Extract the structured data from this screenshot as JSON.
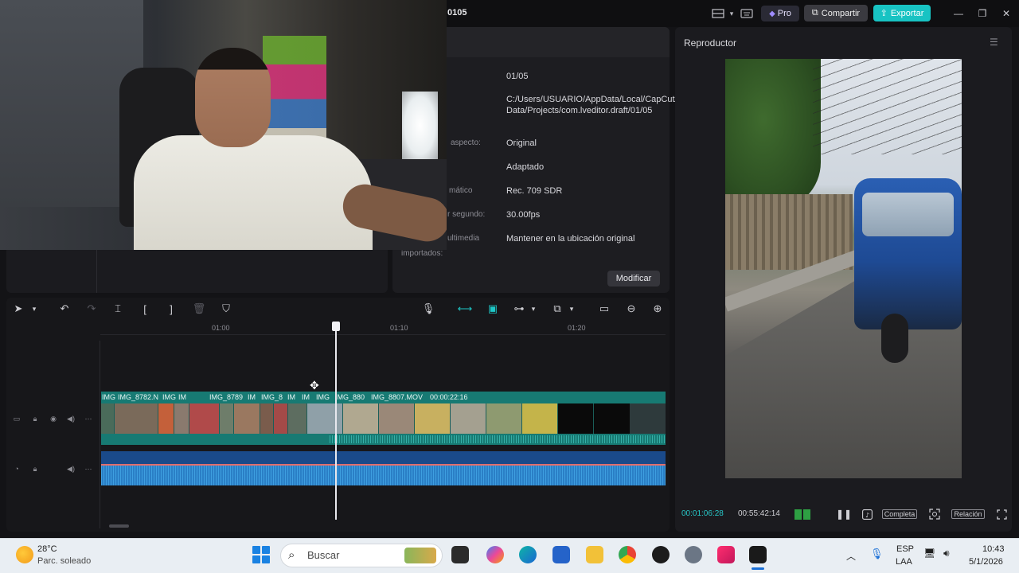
{
  "titlebar": {
    "project_name": "0105",
    "pro_label": "Pro",
    "share_label": "Compartir",
    "export_label": "Exportar",
    "icons": [
      "layout-icon",
      "chevron-down-icon",
      "keyboard-icon",
      "minimize-icon",
      "maximize-icon",
      "close-icon"
    ]
  },
  "info": {
    "rows": [
      {
        "label": "",
        "value": "01/05"
      },
      {
        "label": "",
        "value": "C:/Users/USUARIO/AppData/Local/CapCut/User Data/Projects/com.lveditor.draft/01/05"
      },
      {
        "label": "aspecto:",
        "value": "Original"
      },
      {
        "label": "",
        "value": "Adaptado"
      },
      {
        "label": "mático",
        "value": "Rec. 709 SDR"
      },
      {
        "label": "r segundo:",
        "value": "30.00fps"
      },
      {
        "label": "ultimedia",
        "value": "Mantener en la ubicación original"
      },
      {
        "label": "importados:",
        "value": ""
      }
    ],
    "modify_label": "Modificar"
  },
  "player": {
    "title": "Reproductor",
    "current_time": "00:01:06:28",
    "total_time": "00:55:42:14",
    "full_label": "Completa",
    "ratio_label": "Relación"
  },
  "timeline": {
    "ruler": [
      "01:00",
      "01:10",
      "01:20"
    ],
    "clip_labels": [
      "IMG",
      "IMG_8782.N",
      "IMG",
      "IM",
      "IMG_8789",
      "IM",
      "IMG_8",
      "IM",
      "IM",
      "IMG",
      "IMG_880",
      "IMG_8807.MOV",
      "00:00:22:16"
    ],
    "accent": "#1ec8c8",
    "video_track_color": "#177a73",
    "audio_track_color": "#1a4a8a"
  },
  "taskbar": {
    "temperature": "28°C",
    "condition": "Parc. soleado",
    "search_placeholder": "Buscar",
    "lang_top": "ESP",
    "lang_bottom": "LAA",
    "time": "10:43",
    "date": "5/1/2026"
  }
}
